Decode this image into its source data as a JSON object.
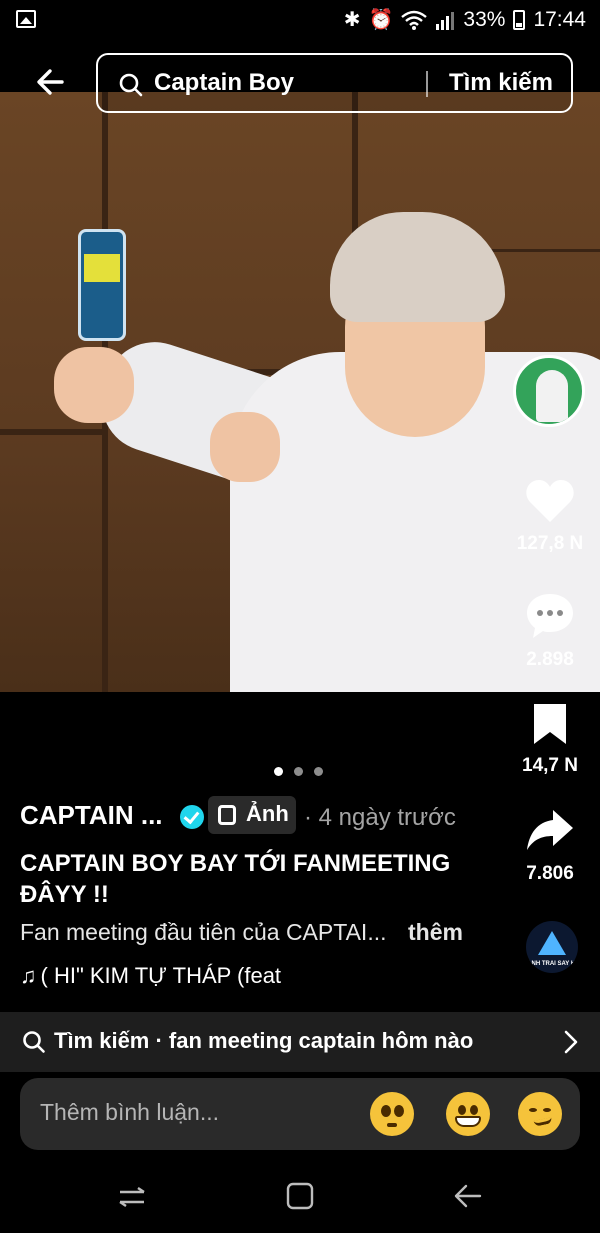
{
  "status_bar": {
    "battery_percent": "33%",
    "time": "17:44",
    "icons": [
      "gallery-icon",
      "bluetooth-icon",
      "alarm-icon",
      "wifi-icon",
      "signal-icon",
      "battery-icon"
    ]
  },
  "search": {
    "query": "Captain Boy",
    "button_label": "Tìm kiếm"
  },
  "carousel": {
    "pages": 3,
    "active": 1
  },
  "rail": {
    "likes": "127,8 N",
    "comments": "2.898",
    "saves": "14,7 N",
    "shares": "7.806",
    "album_text": "ANH TRAI SAY HI"
  },
  "post": {
    "author": "CAPTAIN ...",
    "badge_label": "Ảnh",
    "time": "· 4 ngày trước",
    "title": "CAPTAIN BOY BAY TỚI FANMEETING ĐÂYY !!",
    "description": "Fan meeting đầu tiên của CAPTAI...",
    "more_label": "thêm",
    "music": "( HI\"     KIM TỰ THÁP (feat"
  },
  "related_search": {
    "text": "Tìm kiếm · fan meeting captain hôm nào"
  },
  "comment_bar": {
    "placeholder": "Thêm bình luận..."
  },
  "colors": {
    "background": "#000000",
    "verified": "#20d5ec",
    "muted_text": "#a4a4a4",
    "input_bg": "#2a2a2a"
  }
}
